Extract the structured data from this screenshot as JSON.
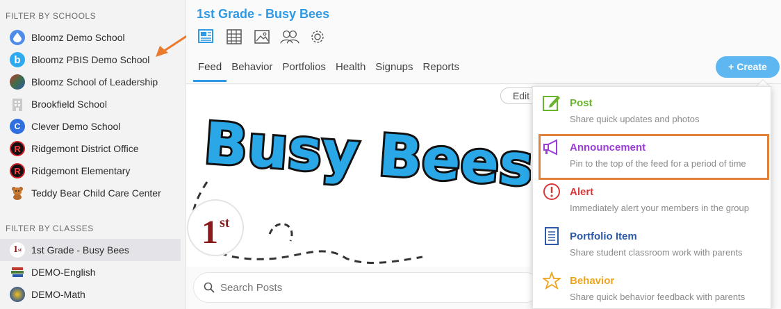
{
  "sidebar": {
    "schools_title": "FILTER BY SCHOOLS",
    "classes_title": "FILTER BY CLASSES",
    "schools": [
      {
        "label": "Bloomz Demo School",
        "color": "#4f8be8",
        "glyph": "●"
      },
      {
        "label": "Bloomz PBIS Demo School",
        "color": "#2eaaf0",
        "glyph": "b"
      },
      {
        "label": "Bloomz School of Leadership",
        "color": "#3d6e4a",
        "glyph": "◐"
      },
      {
        "label": "Brookfield School",
        "color": "#c9c9c9",
        "glyph": "▦"
      },
      {
        "label": "Clever Demo School",
        "color": "#2f6fe0",
        "glyph": "C"
      },
      {
        "label": "Ridgemont District Office",
        "color": "#111111",
        "glyph": "R"
      },
      {
        "label": "Ridgemont Elementary",
        "color": "#111111",
        "glyph": "R"
      },
      {
        "label": "Teddy Bear Child Care Center",
        "color": "#b56a2d",
        "glyph": "♣"
      }
    ],
    "classes": [
      {
        "label": "1st Grade - Busy Bees",
        "color": "#ffffff",
        "glyph": "1"
      },
      {
        "label": "DEMO-English",
        "color": "#4a7b3a",
        "glyph": "▤"
      },
      {
        "label": "DEMO-Math",
        "color": "#3b5b8a",
        "glyph": "◉"
      }
    ]
  },
  "main": {
    "group_title": "1st Grade - Busy Bees",
    "tabs": [
      "Feed",
      "Behavior",
      "Portfolios",
      "Health",
      "Signups",
      "Reports"
    ],
    "create_label": "+ Create",
    "edit_label": "Edit",
    "search_placeholder": "Search Posts",
    "banner_text": "Busy Bees",
    "banner_grade": "1",
    "banner_grade_suffix": "st"
  },
  "dropdown": {
    "items": [
      {
        "title": "Post",
        "desc": "Share quick updates and photos",
        "color": "#6ab42d"
      },
      {
        "title": "Announcement",
        "desc": "Pin to the top of the feed for a period of time",
        "color": "#9b3cd6"
      },
      {
        "title": "Alert",
        "desc": "Immediately alert your members in the group",
        "color": "#d9383a"
      },
      {
        "title": "Portfolio Item",
        "desc": "Share student classroom work with parents",
        "color": "#2c5aa8"
      },
      {
        "title": "Behavior",
        "desc": "Share quick behavior feedback with parents",
        "color": "#f0a31c"
      }
    ]
  }
}
